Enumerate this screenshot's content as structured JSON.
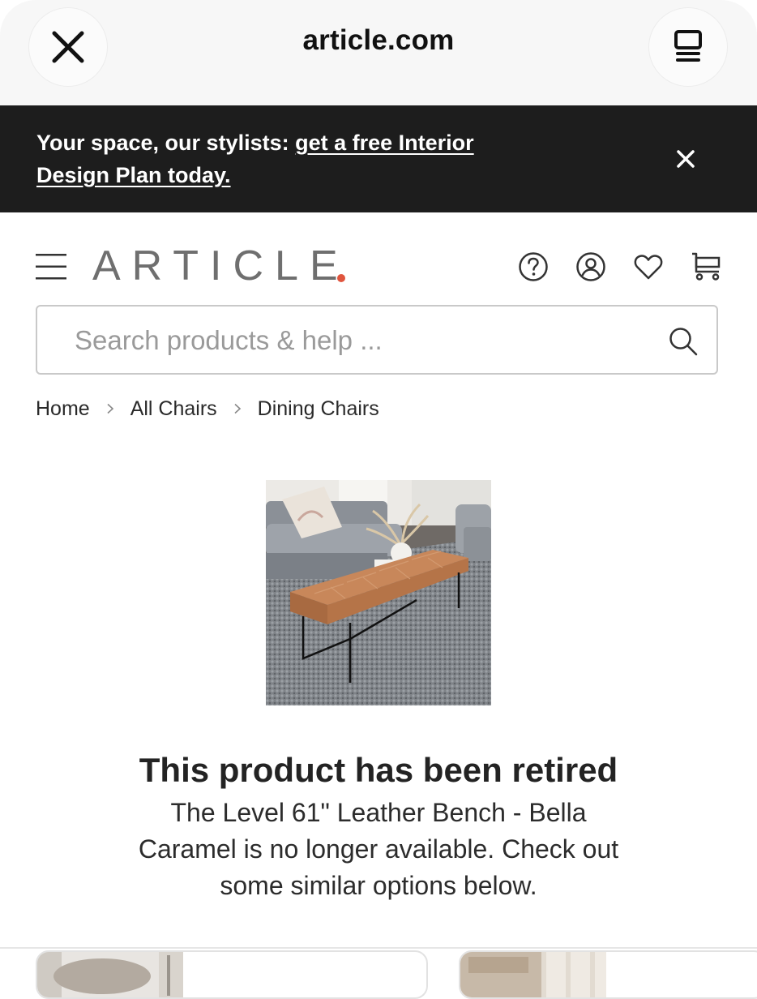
{
  "browser": {
    "url": "article.com",
    "close_icon": "close-icon",
    "tabs_icon": "tabs-icon"
  },
  "promo": {
    "text_plain": "Your space, our stylists: ",
    "text_link": "get a free Interior Design Plan today.",
    "close_icon": "close-icon"
  },
  "header": {
    "logo_text": "ARTICLE",
    "logo_dot_color": "#e0553e",
    "icons": [
      "menu-icon",
      "help-icon",
      "account-icon",
      "heart-icon",
      "cart-icon"
    ]
  },
  "search": {
    "placeholder": "Search products & help ...",
    "value": ""
  },
  "breadcrumb": {
    "items": [
      "Home",
      "All Chairs",
      "Dining Chairs"
    ]
  },
  "product": {
    "retired_title": "This product has been retired",
    "retired_message": "The Level 61\" Leather Bench - Bella Caramel is no longer available. Check out some similar options below."
  }
}
